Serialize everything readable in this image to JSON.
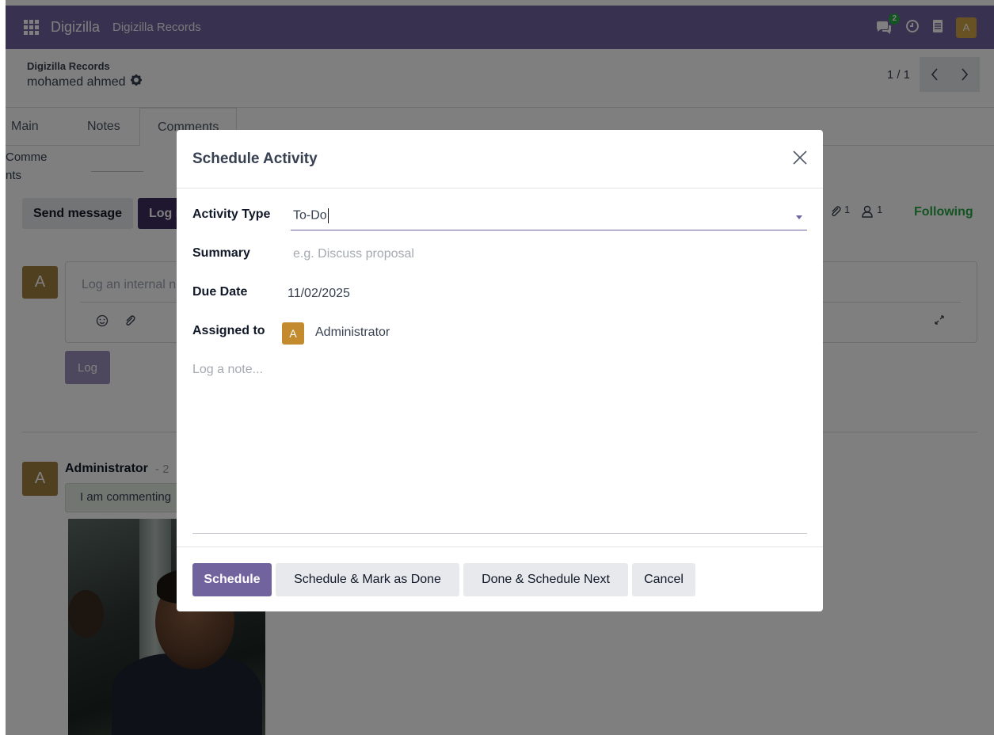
{
  "navbar": {
    "brand": "Digizilla",
    "menu_item": "Digizilla Records",
    "chat_count": "2",
    "user_initial": "A"
  },
  "control": {
    "breadcrumb": "Digizilla Records",
    "record_name": "mohamed ahmed",
    "pager_value": "1 / 1",
    "prev_glyph": "‹",
    "next_glyph": "›"
  },
  "tabs": [
    {
      "label": "Main"
    },
    {
      "label": "Notes"
    },
    {
      "label": "Comments"
    }
  ],
  "form": {
    "field_label": "Comme\nnts"
  },
  "chatter": {
    "send_message": "Send message",
    "log_note": "Log note",
    "attachments_count": "1",
    "followers_count": "1",
    "following": "Following",
    "composer_avatar": "A",
    "composer_placeholder": "Log an internal note...",
    "log_button": "Log",
    "message": {
      "avatar": "A",
      "author": "Administrator",
      "date": "- 2",
      "body": "I am commenting"
    }
  },
  "modal": {
    "title": "Schedule Activity",
    "activity_type_label": "Activity Type",
    "activity_type_value": "To-Do",
    "summary_label": "Summary",
    "summary_placeholder": "e.g. Discuss proposal",
    "due_date_label": "Due Date",
    "due_date_value": "11/02/2025",
    "assigned_label": "Assigned to",
    "assigned_initial": "A",
    "assigned_value": "Administrator",
    "note_placeholder": "Log a note...",
    "buttons": {
      "schedule": "Schedule",
      "schedule_done": "Schedule & Mark as Done",
      "done_next": "Done & Schedule Next",
      "cancel": "Cancel"
    }
  },
  "colors": {
    "brand": "#71639e",
    "following": "#28a745",
    "avatar": "#a3813e"
  },
  "icons": [
    "apps-grid-icon",
    "chat-icon",
    "clock-icon",
    "document-icon",
    "gear-icon",
    "paperclip-icon",
    "user-icon",
    "smiley-icon",
    "expand-icon",
    "close-icon",
    "chevron-down-icon"
  ]
}
